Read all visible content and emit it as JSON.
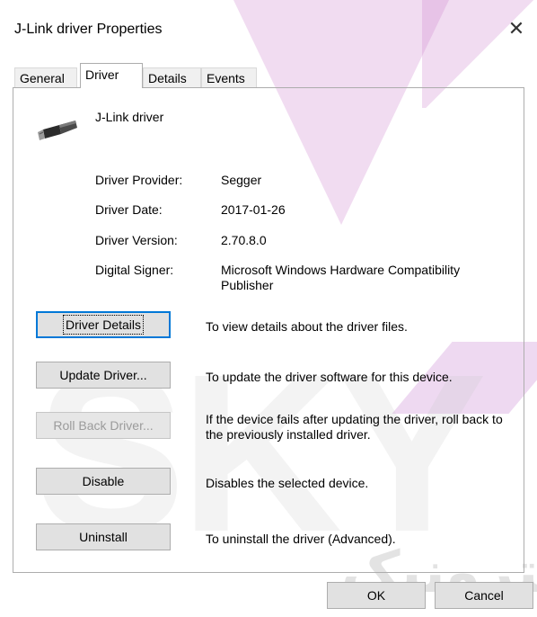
{
  "window": {
    "title": "J-Link driver Properties",
    "close_glyph": "✕"
  },
  "tabs": [
    {
      "label": "General",
      "active": false
    },
    {
      "label": "Driver",
      "active": true
    },
    {
      "label": "Details",
      "active": false
    },
    {
      "label": "Events",
      "active": false
    }
  ],
  "device": {
    "name": "J-Link driver",
    "icon": "usb-plug-icon"
  },
  "properties": {
    "provider_label": "Driver Provider:",
    "provider_value": "Segger",
    "date_label": "Driver Date:",
    "date_value": "2017-01-26",
    "version_label": "Driver Version:",
    "version_value": "2.70.8.0",
    "signer_label": "Digital Signer:",
    "signer_value": "Microsoft Windows Hardware Compatibility Publisher"
  },
  "actions": {
    "details": {
      "label": "Driver Details",
      "desc": "To view details about the driver files."
    },
    "update": {
      "label": "Update Driver...",
      "desc": "To update the driver software for this device."
    },
    "rollback": {
      "label": "Roll Back Driver...",
      "desc": "If the device fails after updating the driver, roll back to the previously installed driver.",
      "enabled": false
    },
    "disable": {
      "label": "Disable",
      "desc": "Disables the selected device."
    },
    "uninstall": {
      "label": "Uninstall",
      "desc": "To uninstall the driver (Advanced)."
    }
  },
  "footer": {
    "ok_label": "OK",
    "cancel_label": "Cancel"
  },
  "watermark": {
    "text": "SKY",
    "text_fa": "لکترونیک"
  },
  "colors": {
    "accent": "#0078d7",
    "watermark_pink": "#cd82cd"
  }
}
